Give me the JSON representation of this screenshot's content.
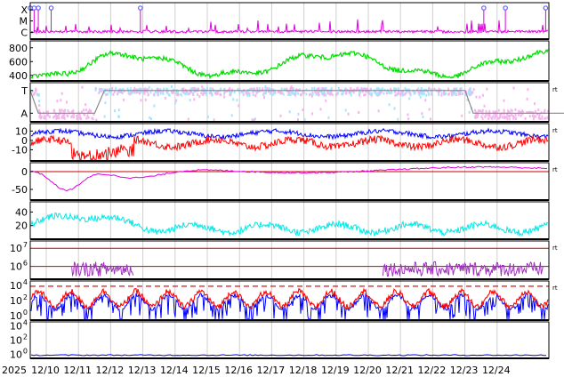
{
  "year_label": "2025",
  "x_labels": [
    "12/10",
    "12/11",
    "12/12",
    "12/13",
    "12/14",
    "12/15",
    "12/16",
    "12/17",
    "12/18",
    "12/19",
    "12/20",
    "12/21",
    "12/22",
    "12/23",
    "12/24"
  ],
  "side_marks": {
    "panel3": "rt",
    "panel4": "rt",
    "panel5": "rt",
    "panel8": "rt",
    "panel9": "rt"
  },
  "colors": {
    "magenta": "#e000e0",
    "green": "#00dd00",
    "lightblue": "#a8e4ff",
    "pink": "#f6b4ee",
    "gray": "#888888",
    "blue": "#0000ff",
    "red": "#ff0000",
    "cyan": "#00e8e8",
    "purple": "#a030c0",
    "darkred": "#cc0000",
    "marker": "#6060ff",
    "grid": "#d0d0d0"
  },
  "chart_data": [
    {
      "type": "line",
      "name": "xray-class",
      "yticks": [
        "X",
        "M",
        "C"
      ],
      "flare_markers_day": [
        0.0,
        0.12,
        0.25,
        0.65,
        3.42,
        14.08,
        14.75,
        16.0
      ],
      "trace_kind": "spiky-low"
    },
    {
      "type": "line",
      "name": "speed",
      "yticks": [
        800,
        600,
        400
      ],
      "ylim": [
        320,
        900
      ],
      "series_color": "green",
      "trace_kind": "wavy-400-750"
    },
    {
      "type": "scatter",
      "name": "toward-away",
      "yticks": [
        "T",
        "A"
      ],
      "state_line": [
        [
          0.0,
          "T"
        ],
        [
          0.25,
          "A"
        ],
        [
          2.0,
          "A"
        ],
        [
          2.3,
          "T"
        ],
        [
          13.5,
          "T"
        ],
        [
          13.75,
          "A"
        ],
        [
          21.0,
          "A"
        ]
      ]
    },
    {
      "type": "line",
      "name": "bfield",
      "yticks": [
        10,
        0,
        -10
      ],
      "ylim": [
        -22,
        18
      ],
      "series": [
        {
          "color": "blue",
          "kind": "positive-band"
        },
        {
          "color": "red",
          "kind": "negative-band"
        }
      ]
    },
    {
      "type": "line",
      "name": "index-a",
      "yticks": [
        0,
        -50
      ],
      "ylim": [
        -80,
        25
      ],
      "reference_value": 0,
      "series_color": "magenta",
      "trace_kind": "dip-recover"
    },
    {
      "type": "line",
      "name": "index-b",
      "yticks": [
        40,
        20
      ],
      "ylim": [
        0,
        55
      ],
      "series_color": "cyan",
      "trace_kind": "spiky-10-45"
    },
    {
      "type": "line",
      "name": "proton-flux",
      "yticks": [
        "10^7",
        "10^6"
      ],
      "log_scale": true,
      "ylim_exp": [
        5.3,
        7.4
      ],
      "reference_exponents": [
        7,
        6
      ],
      "series_color": "purple",
      "trace_kind": "sparse-5-6.3"
    },
    {
      "type": "line",
      "name": "electron-flux",
      "yticks": [
        "10^4",
        "10^2",
        "10^0"
      ],
      "log_scale": true,
      "ylim_exp": [
        -0.6,
        4.6
      ],
      "reference_exponent": 3.9,
      "series": [
        {
          "color": "red",
          "kind": "diurnal"
        },
        {
          "color": "blue",
          "kind": "diurnal-dips"
        }
      ]
    },
    {
      "type": "line",
      "name": "low-flux",
      "yticks": [
        "10^4",
        "10^2",
        "10^0"
      ],
      "log_scale": true,
      "ylim_exp": [
        -0.6,
        4.6
      ],
      "series_color": "blue",
      "trace_kind": "flat-baseline"
    }
  ]
}
